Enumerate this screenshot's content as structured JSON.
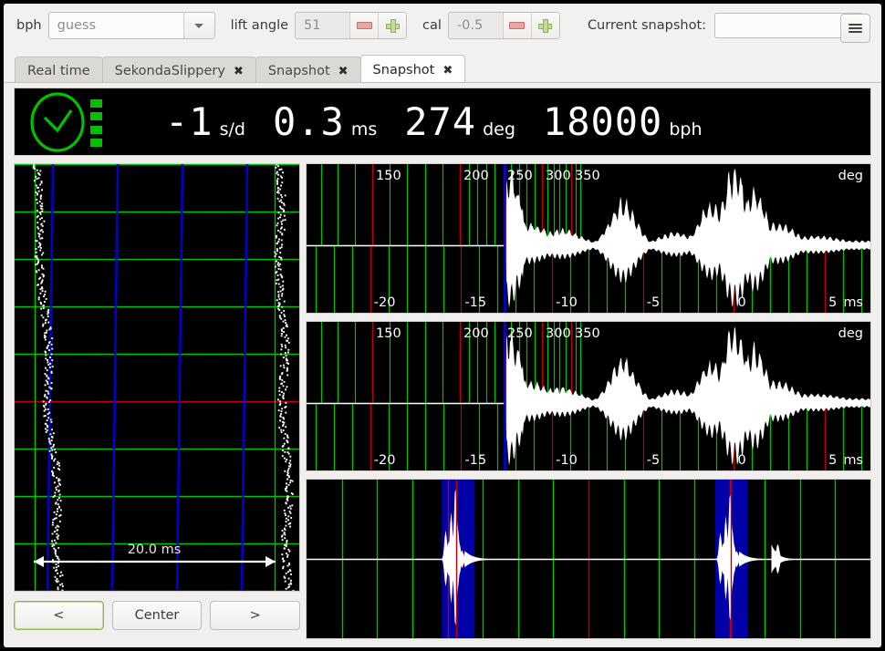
{
  "toolbar": {
    "bph_label": "bph",
    "bph_value": "guess",
    "bph_placeholder": "guess",
    "lift_angle_label": "lift angle",
    "lift_angle_value": "51",
    "cal_label": "cal",
    "cal_value": "-0.5",
    "snapshot_label": "Current snapshot:",
    "snapshot_value": "",
    "snapshot_placeholder": "",
    "minus_icon": "minus-icon",
    "plus_icon": "plus-icon",
    "dropdown_icon": "chevron-down-icon",
    "menu_icon": "hamburger-menu-icon"
  },
  "tabs": [
    {
      "label": "Real time",
      "closable": false,
      "active": false
    },
    {
      "label": "SekondaSlippery",
      "closable": true,
      "active": false,
      "close_icon": "close-icon"
    },
    {
      "label": "Snapshot",
      "closable": true,
      "active": false,
      "close_icon": "close-icon"
    },
    {
      "label": "Snapshot",
      "closable": true,
      "active": true,
      "close_icon": "close-icon"
    }
  ],
  "readout": {
    "status_icon": "clock-ok-icon",
    "signal_icon": "signal-bars-icon",
    "accent_color": "#00c000",
    "metrics": [
      {
        "value": "-1",
        "unit": "s/d"
      },
      {
        "value": "0.3",
        "unit": "ms"
      },
      {
        "value": "274",
        "unit": "deg"
      },
      {
        "value": "18000",
        "unit": "bph"
      }
    ]
  },
  "tape": {
    "scale_label": "20.0 ms",
    "grid_color": "#00c000",
    "marker_color": "#0000d0",
    "center_color": "#c00000",
    "trace_color": "#ffffff"
  },
  "controls": {
    "prev_label": "<",
    "center_label": "Center",
    "next_label": ">"
  },
  "chart_data": [
    {
      "type": "scatter",
      "name": "beat-tape",
      "title": "",
      "xlabel": "20.0 ms",
      "ylabel": "",
      "grid": true,
      "legend": "none",
      "xlim": [
        0,
        20
      ],
      "ylim": [
        0,
        470
      ],
      "annotations": [
        "20.0 ms"
      ],
      "series": [
        {
          "name": "tick-trace",
          "drift_ms_per_panel": 1.6,
          "start_ms": 1.0,
          "end_ms": 3.1,
          "jitter_ms": 0.35
        },
        {
          "name": "tock-trace",
          "drift_ms_per_panel": 1.6,
          "start_ms": 18.6,
          "end_ms": 20.4,
          "jitter_ms": 0.35
        }
      ],
      "vertical_markers_ms": [
        1.9,
        6.9,
        11.9,
        16.9
      ],
      "center_line_ms": 0
    },
    {
      "type": "area",
      "name": "waveform-top",
      "title": "",
      "xlabel": "ms",
      "top_axis_label": "deg",
      "x_ticks": [
        -20,
        -15,
        -10,
        -5,
        0,
        5
      ],
      "top_ticks": [
        150,
        200,
        250,
        300,
        350
      ],
      "grid": true,
      "legend": "none",
      "xlim": [
        -23.5,
        7.5
      ],
      "cursor_ms": -12.6,
      "peaks_ms": [
        -12.4,
        -6.0,
        -1.2,
        0.0,
        2.0
      ]
    },
    {
      "type": "area",
      "name": "waveform-bottom",
      "title": "",
      "xlabel": "ms",
      "top_axis_label": "deg",
      "x_ticks": [
        -20,
        -15,
        -10,
        -5,
        0,
        5
      ],
      "top_ticks": [
        150,
        200,
        250,
        300,
        350
      ],
      "grid": true,
      "legend": "none",
      "xlim": [
        -23.5,
        7.5
      ],
      "cursor_ms": -12.6,
      "peaks_ms": [
        -12.4,
        -6.0,
        -1.2,
        0.0,
        2.0
      ]
    },
    {
      "type": "area",
      "name": "pulse-overview",
      "title": "",
      "xlabel": "",
      "grid": true,
      "legend": "none",
      "highlight_color": "#0000a8",
      "burst_positions_pct": [
        26.5,
        75.0
      ],
      "highlight_spans_pct": [
        [
          24.0,
          29.8
        ],
        [
          72.5,
          78.3
        ]
      ]
    }
  ]
}
